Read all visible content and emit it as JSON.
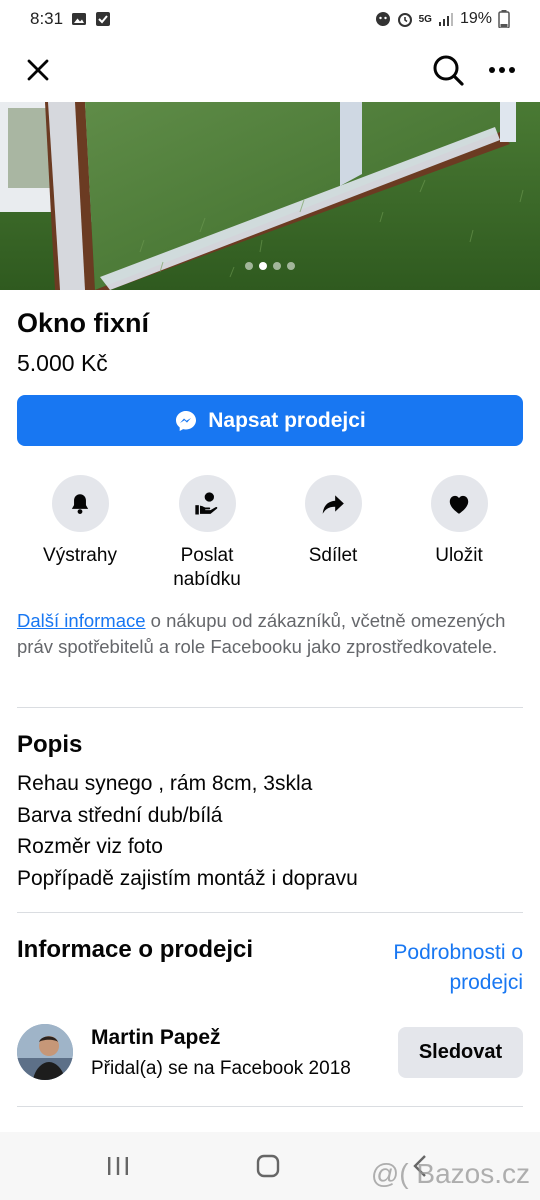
{
  "status_bar": {
    "time": "8:31",
    "network": "5G",
    "battery": "19%"
  },
  "top_bar": {
    "close_icon": "close-icon",
    "search_icon": "search-icon",
    "more_icon": "more-icon"
  },
  "listing": {
    "title": "Okno fixní",
    "price": "5.000 Kč",
    "photo_count": 4,
    "active_photo": 2
  },
  "cta": {
    "label": "Napsat prodejci",
    "icon": "messenger-icon",
    "color": "#1877f2"
  },
  "actions": [
    {
      "label": "Výstrahy",
      "icon": "bell-icon"
    },
    {
      "label": "Poslat nabídku",
      "icon": "offer-icon"
    },
    {
      "label": "Sdílet",
      "icon": "share-icon"
    },
    {
      "label": "Uložit",
      "icon": "heart-icon"
    }
  ],
  "info": {
    "link_text": "Další informace",
    "text": " o nákupu od zákazníků, včetně omezených práv spotřebitelů a role Facebooku jako zprostředkovatele."
  },
  "description": {
    "heading": "Popis",
    "lines": [
      "Rehau synego , rám 8cm, 3skla",
      "Barva střední dub/bílá",
      "Rozměr viz foto",
      "Popřípadě zajistím montáž i dopravu"
    ]
  },
  "seller": {
    "heading": "Informace o prodejci",
    "details_link_line1": "Podrobnosti o",
    "details_link_line2": "prodejci",
    "name": "Martin Papež",
    "joined": "Přidal(a) se na Facebook 2018",
    "follow_label": "Sledovat"
  },
  "nav_bar": {
    "recents_icon": "recents-icon",
    "home_icon": "home-icon",
    "back_icon": "back-icon"
  },
  "watermark": "@( Bazos.cz"
}
